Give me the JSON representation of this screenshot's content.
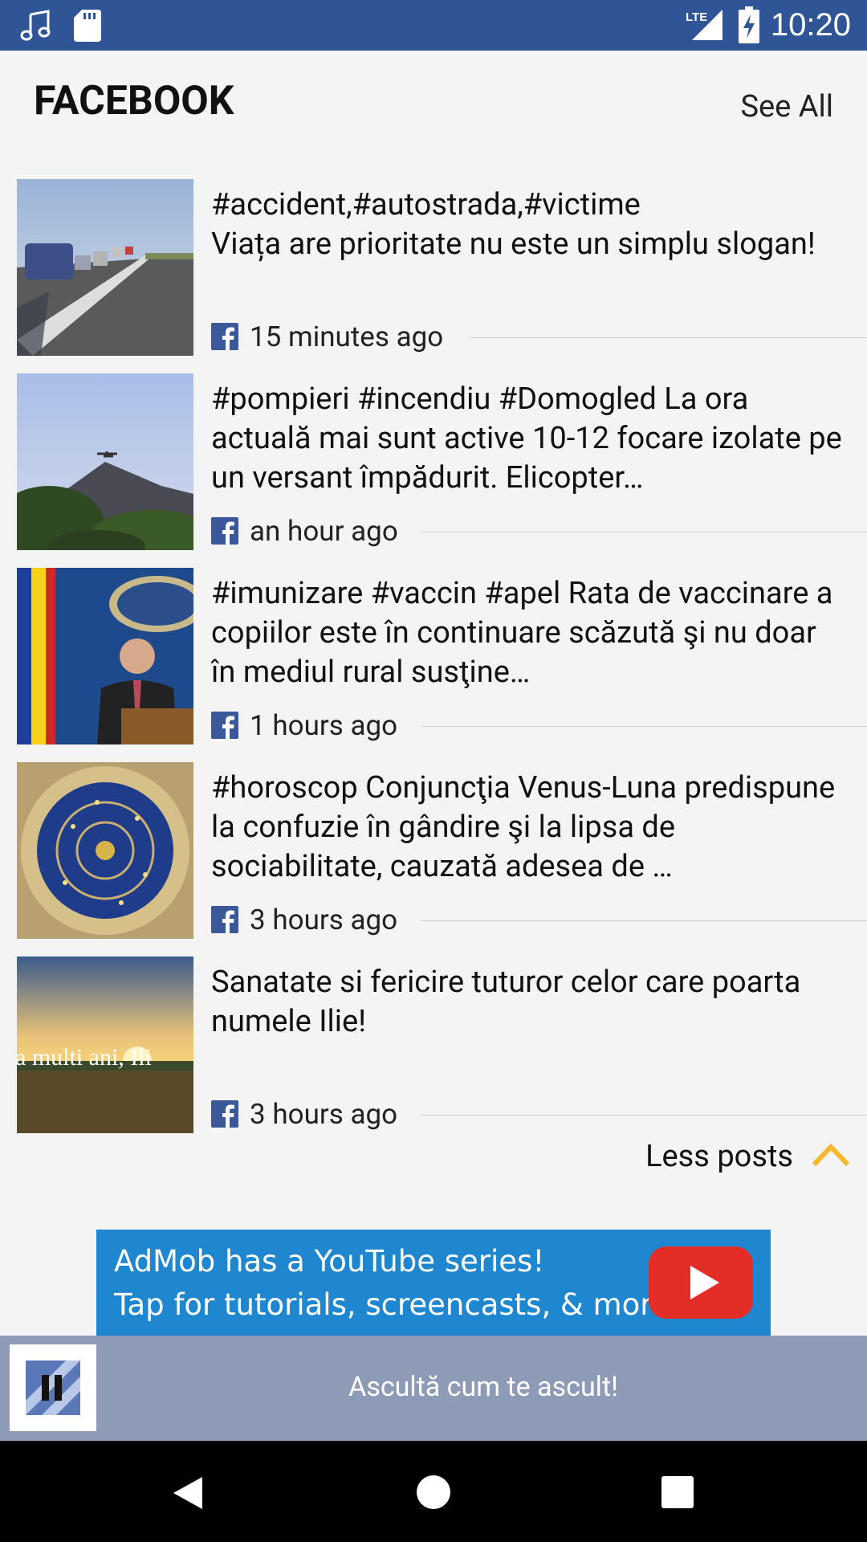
{
  "status_bar": {
    "time": "10:20",
    "network": "LTE"
  },
  "header": {
    "title": "FACEBOOK",
    "see_all": "See All"
  },
  "posts": [
    {
      "text": "#accident,#autostrada,#victime\nViața are prioritate nu este un simplu slogan!",
      "time": "15 minutes ago",
      "thumb": "highway"
    },
    {
      "text": "#pompieri #incendiu #Domogled La ora actuală mai sunt active 10-12 focare izolate pe un versant împădurit. Elicopter…",
      "time": "an hour ago",
      "thumb": "forest-helicopter"
    },
    {
      "text": "#imunizare #vaccin #apel Rata de vaccinare a copiilor este în continuare scăzută şi nu doar în mediul rural susţine…",
      "time": "1 hours ago",
      "thumb": "speaker-podium"
    },
    {
      "text": "#horoscop Conjuncţia Venus-Luna predispune la confuzie în gândire şi la lipsa de sociabilitate, cauzată adesea de …",
      "time": "3 hours ago",
      "thumb": "zodiac-clock"
    },
    {
      "text": "Sanatate si fericire tuturor celor care poarta numele Ilie!",
      "time": "3 hours ago",
      "thumb": "sunset-field",
      "thumb_overlay": "a multi ani, Ili"
    }
  ],
  "less_posts": "Less posts",
  "ad": {
    "line1": "AdMob has a YouTube series!",
    "line2": "Tap for tutorials, screencasts, & more."
  },
  "player": {
    "label": "Ascultă cum te ascult!"
  },
  "colors": {
    "status_bar": "#2f5597",
    "accent": "#f5b82e",
    "facebook": "#3b5998",
    "player": "#8d9bb6"
  }
}
